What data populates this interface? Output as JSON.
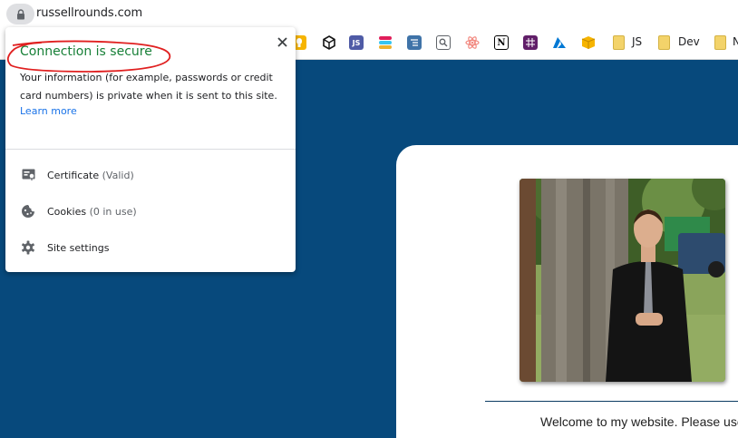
{
  "address_bar": {
    "url": "russellrounds.com"
  },
  "bookmarks": {
    "items": [
      {
        "icon": "google-keep-icon",
        "color": "#f6b400"
      },
      {
        "icon": "codesandbox-icon",
        "color": "#151515"
      },
      {
        "icon": "js-icon",
        "label": "JS",
        "color": "#4f5ba6"
      },
      {
        "icon": "slack-icon",
        "color": "#e01e5a"
      },
      {
        "icon": "list-app-icon",
        "color": "#3f73a8"
      },
      {
        "icon": "magnifier-app-icon",
        "color": "#5f6368"
      },
      {
        "icon": "react-icon",
        "color": "#f28b82"
      },
      {
        "icon": "notion-icon",
        "color": "#000000"
      },
      {
        "icon": "slack-grid-icon",
        "color": "#611f69"
      },
      {
        "icon": "azure-icon",
        "color": "#0078d4"
      },
      {
        "icon": "package-icon",
        "color": "#f6b400"
      }
    ],
    "folders": [
      {
        "label": "JS"
      },
      {
        "label": "Dev"
      },
      {
        "label": "N"
      }
    ]
  },
  "popup": {
    "title": "Connection is secure",
    "description": "Your information (for example, passwords or credit card numbers) is private when it is sent to this site.",
    "learn_more": "Learn more",
    "rows": [
      {
        "label": "Certificate",
        "sub": "(Valid)",
        "icon": "certificate-icon"
      },
      {
        "label": "Cookies",
        "sub": "(0 in use)",
        "icon": "cookie-icon"
      },
      {
        "label": "Site settings",
        "sub": "",
        "icon": "gear-icon"
      }
    ],
    "title_color": "#188038",
    "link_color": "#1a73e8",
    "annotation_color": "#e02020"
  },
  "page": {
    "background_color": "#07497c",
    "welcome_text": "Welcome to my website. Please use"
  }
}
